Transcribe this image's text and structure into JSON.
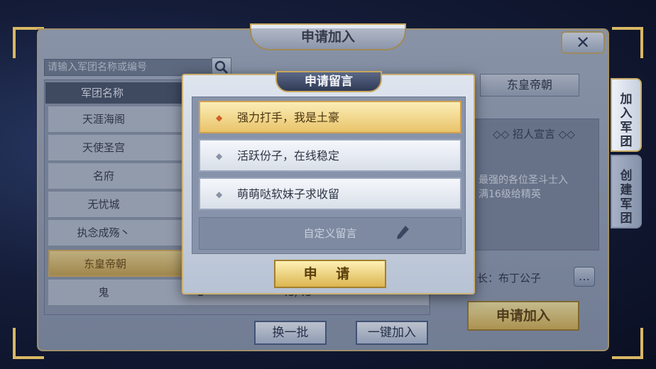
{
  "window": {
    "title": "申请加入",
    "close_icon": "✕"
  },
  "search": {
    "placeholder": "请输入军团名称或编号"
  },
  "list": {
    "header": "军团名称",
    "rows": [
      {
        "name": "天涯海阁",
        "mid": "",
        "count": ""
      },
      {
        "name": "天使圣宫",
        "mid": "",
        "count": ""
      },
      {
        "name": "名府",
        "mid": "",
        "count": ""
      },
      {
        "name": "无忧城",
        "mid": "",
        "count": ""
      },
      {
        "name": "执念成殇丶",
        "mid": "",
        "count": ""
      },
      {
        "name": "东皇帝朝",
        "mid": "",
        "count": ""
      },
      {
        "name": "鬼",
        "mid": "3",
        "count": "45/45"
      }
    ],
    "selected_index": 5
  },
  "buttons": {
    "refresh": "换一批",
    "join_all": "一键加入",
    "apply_join": "申请加入"
  },
  "detail": {
    "guild_name": "东皇帝朝",
    "recruit_title": "招人宣言",
    "recruit_line1": "最强的各位圣斗士入",
    "recruit_line2": "满16级给精英",
    "leader": "长：布丁公子"
  },
  "tabs": {
    "join": "加入军团",
    "create": "创建军团"
  },
  "dialog": {
    "title": "申请留言",
    "options": [
      "强力打手，我是土豪",
      "活跃份子，在线稳定",
      "萌萌哒软妹子求收留"
    ],
    "selected_option": 0,
    "custom_label": "自定义留言",
    "submit": "申 请"
  },
  "colors": {
    "gold": "#d8b454",
    "panel": "#8a97ad",
    "selected_row": "#f0d890"
  }
}
